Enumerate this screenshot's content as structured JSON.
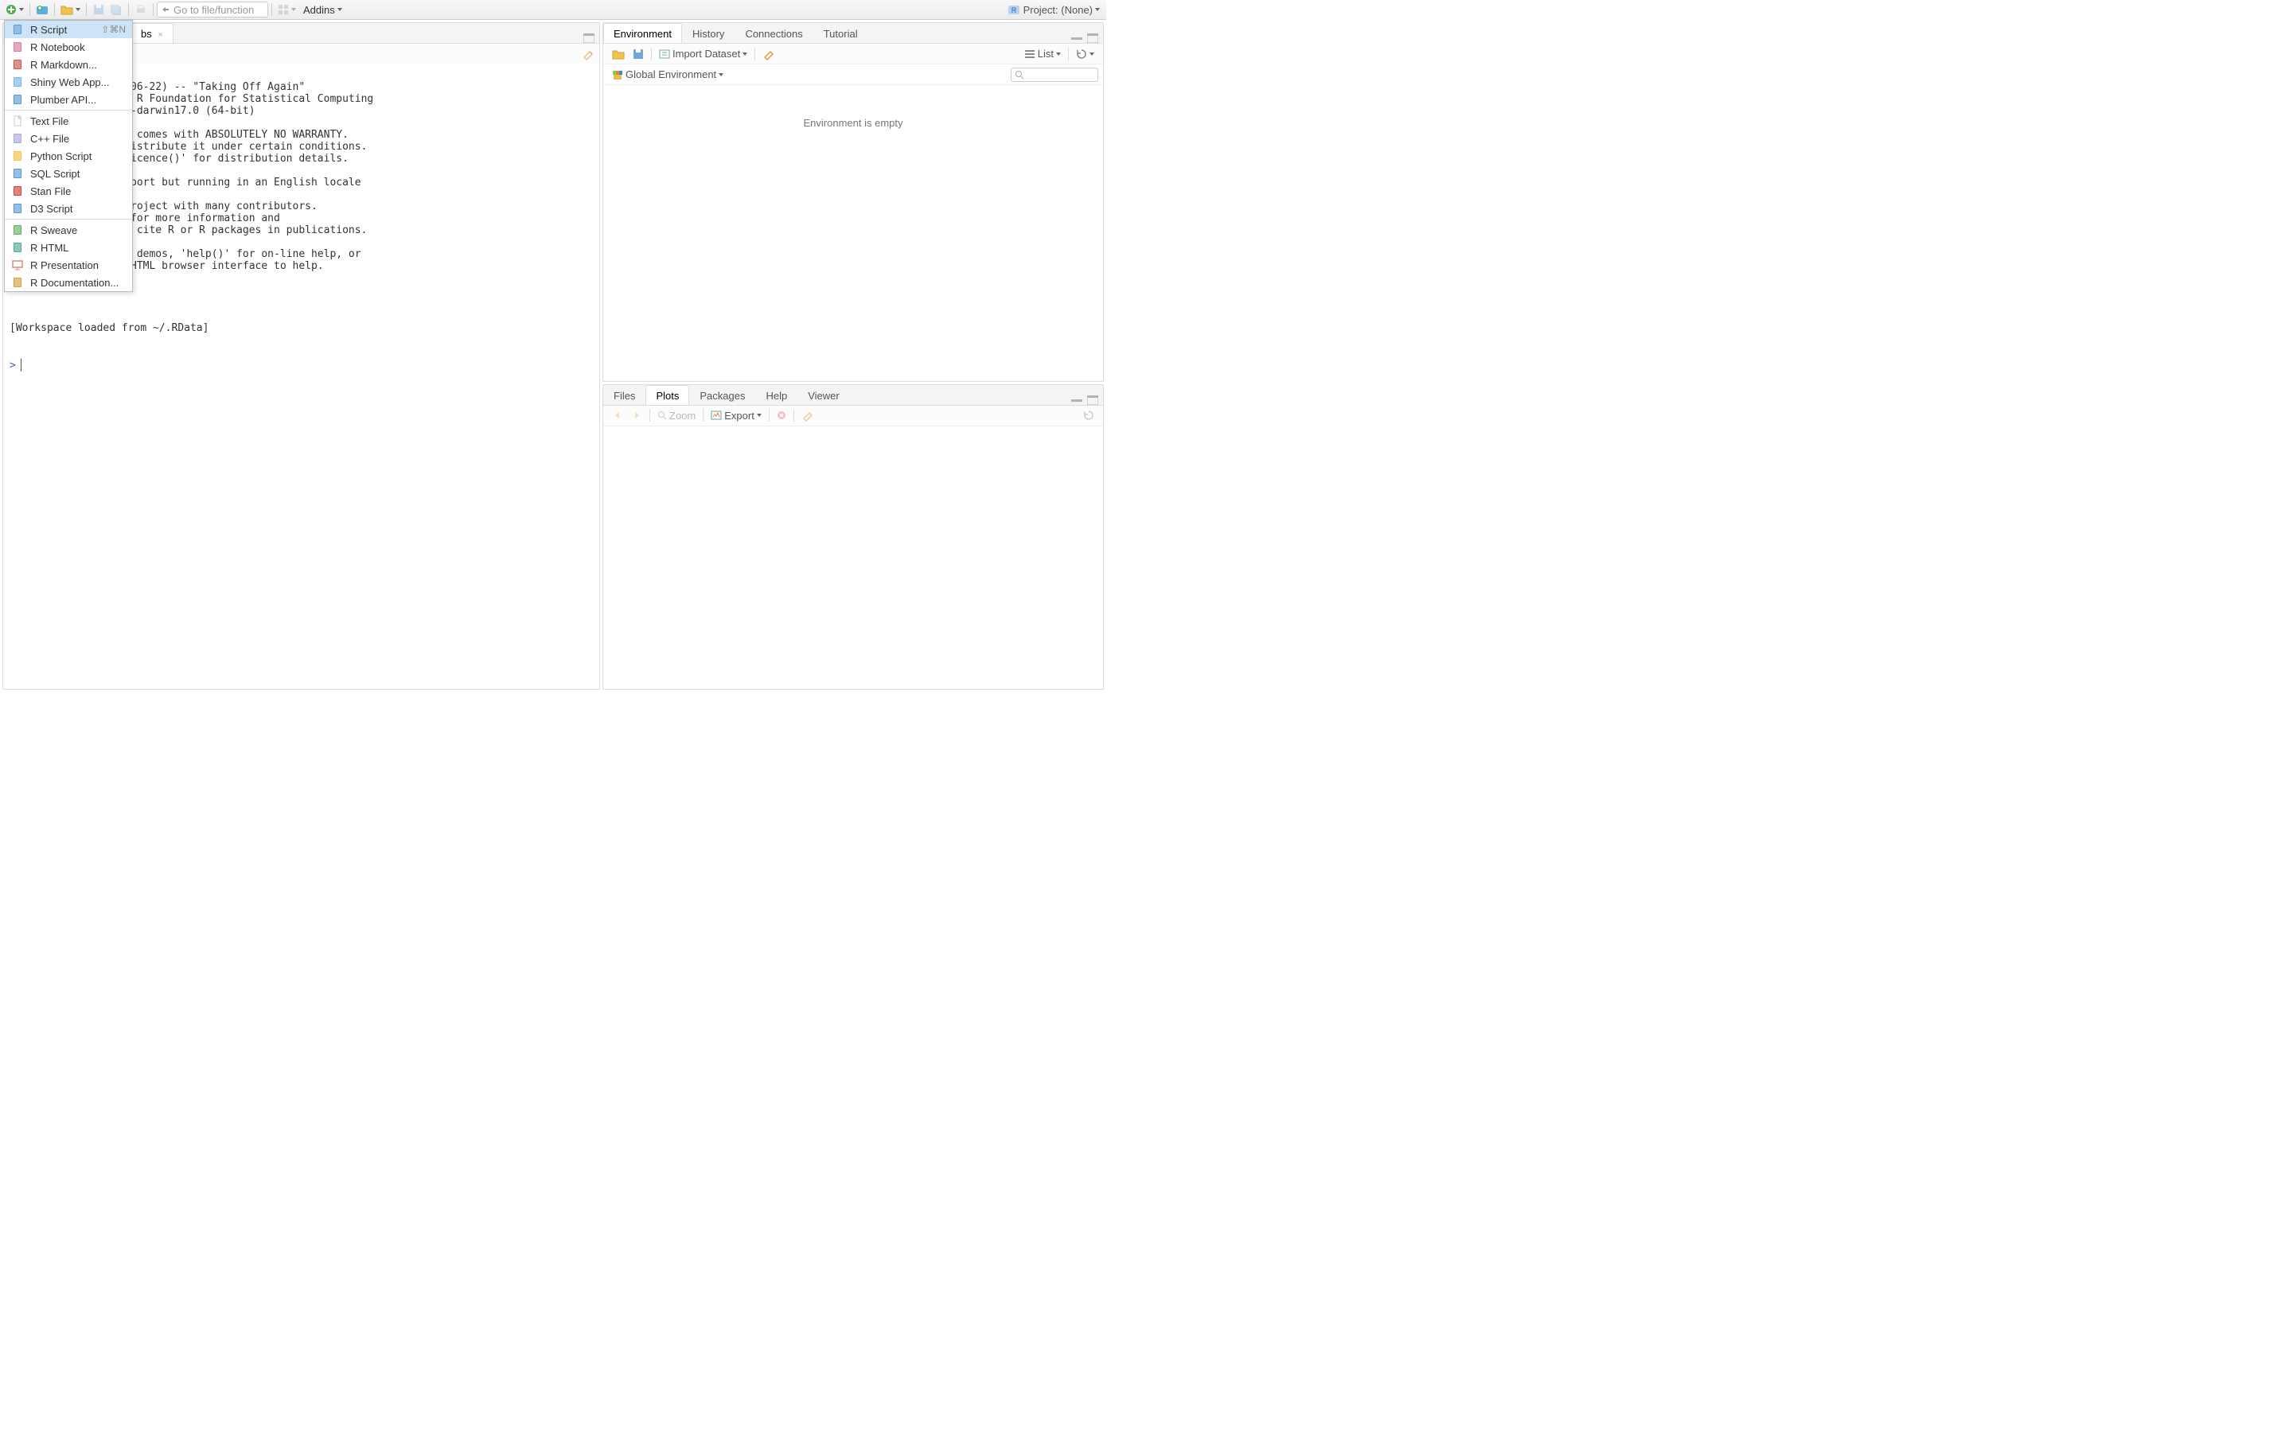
{
  "toolbar": {
    "goto_placeholder": "Go to file/function",
    "addins_label": "Addins",
    "project_label": "Project: (None)"
  },
  "newfile_menu": {
    "items": [
      {
        "label": "R Script",
        "shortcut": "⇧⌘N",
        "icon": "r-script",
        "highlight": true
      },
      {
        "label": "R Notebook",
        "icon": "r-notebook"
      },
      {
        "label": "R Markdown...",
        "icon": "r-markdown"
      },
      {
        "label": "Shiny Web App...",
        "icon": "shiny"
      },
      {
        "label": "Plumber API...",
        "icon": "plumber"
      },
      {
        "sep": true
      },
      {
        "label": "Text File",
        "icon": "text-file"
      },
      {
        "label": "C++ File",
        "icon": "cpp"
      },
      {
        "label": "Python Script",
        "icon": "python"
      },
      {
        "label": "SQL Script",
        "icon": "sql"
      },
      {
        "label": "Stan File",
        "icon": "stan"
      },
      {
        "label": "D3 Script",
        "icon": "d3"
      },
      {
        "sep": true
      },
      {
        "label": "R Sweave",
        "icon": "sweave"
      },
      {
        "label": "R HTML",
        "icon": "rhtml"
      },
      {
        "label": "R Presentation",
        "icon": "presentation"
      },
      {
        "label": "R Documentation...",
        "icon": "rdoc"
      }
    ]
  },
  "console": {
    "tabs": [
      {
        "label": "bs",
        "closable": true
      }
    ],
    "text_lines": [
      "06-22) -- \"Taking Off Again\"",
      " R Foundation for Statistical Computing",
      "-darwin17.0 (64-bit)",
      "",
      " comes with ABSOLUTELY NO WARRANTY.",
      "istribute it under certain conditions.",
      "icence()' for distribution details.",
      "",
      "port but running in an English locale",
      "",
      "roject with many contributors.",
      "for more information and",
      " cite R or R packages in publications.",
      "",
      " demos, 'help()' for on-line help, or",
      "HTML browser interface to help."
    ],
    "workspace_line": "[Workspace loaded from ~/.RData]",
    "prompt": ">"
  },
  "env_pane": {
    "tabs": [
      "Environment",
      "History",
      "Connections",
      "Tutorial"
    ],
    "active_tab": 0,
    "import_label": "Import Dataset",
    "scope_label": "Global Environment",
    "list_label": "List",
    "empty_message": "Environment is empty"
  },
  "plots_pane": {
    "tabs": [
      "Files",
      "Plots",
      "Packages",
      "Help",
      "Viewer"
    ],
    "active_tab": 1,
    "zoom_label": "Zoom",
    "export_label": "Export"
  }
}
